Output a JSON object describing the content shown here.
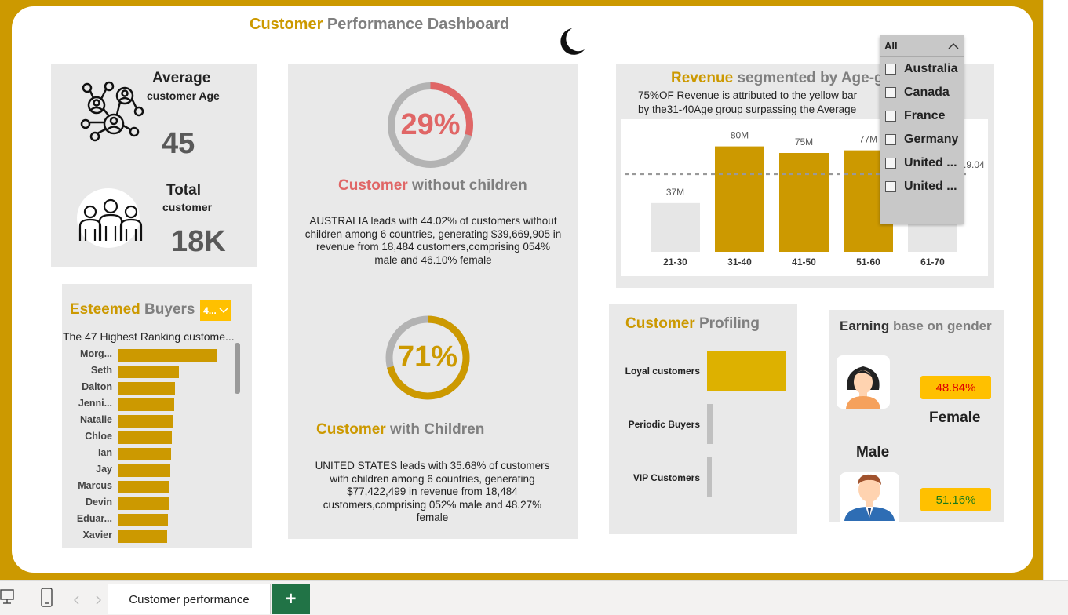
{
  "dashboard": {
    "title_part1": "Customer",
    "title_part2": " Performance Dashboard"
  },
  "age_card": {
    "title": "Average",
    "subtitle": "customer Age",
    "value": "45",
    "total_title": "Total",
    "total_subtitle": "customer",
    "total_value": "18K"
  },
  "donut_without": {
    "percent": "29%",
    "fraction": 0.29,
    "title_part1": "Customer",
    "title_part2": " without children",
    "description": "AUSTRALIA leads with 44.02% of customers without children among 6 countries, generating $39,669,905 in revenue from 18,484 customers,comprising 054% male and  46.10% female",
    "color": "#E06666"
  },
  "donut_with": {
    "percent": "71%",
    "fraction": 0.71,
    "title_part1": "Customer",
    "title_part2": " with Children",
    "description": "UNITED STATES leads with 35.68% of customers with children among 6 countries, generating $77,422,499 in revenue from 18,484 customers,comprising 052% male and  48.27% female",
    "color": "#CC9900"
  },
  "revenue_card": {
    "title_part1": "Revenue",
    "title_part2": " segmented by Age-g",
    "subtitle_line1": "75%OF Revenue is attributed to the yellow bar",
    "subtitle_line2": "by the31-40Age group surpassing the Average",
    "avg_label": ".9.04"
  },
  "chart_data": {
    "type": "bar",
    "categories": [
      "21-30",
      "31-40",
      "41-50",
      "51-60",
      "61-70"
    ],
    "values": [
      37,
      80,
      75,
      77,
      40
    ],
    "data_labels": [
      "37M",
      "80M",
      "75M",
      "77M",
      ""
    ],
    "highlight": [
      false,
      true,
      true,
      true,
      false
    ],
    "average_line": 59.04,
    "ylim": [
      0,
      100
    ],
    "colors": {
      "highlight": "#CC9900",
      "normal": "#e6e6e6",
      "avg_line": "#999999"
    }
  },
  "slicer": {
    "header": "All",
    "items": [
      "Australia",
      "Canada",
      "France",
      "Germany",
      "United ...",
      "United ..."
    ]
  },
  "buyers_card": {
    "title_part1": "Esteemed",
    "title_part2": " Buyers",
    "dropdown_value": "4...",
    "subtitle": "The 47 Highest Ranking custome...",
    "names": [
      "Morg...",
      "Seth",
      "Dalton",
      "Jenni...",
      "Natalie",
      "Chloe",
      "Ian",
      "Jay",
      "Marcus",
      "Devin",
      "Eduar...",
      "Xavier"
    ],
    "values": [
      100,
      62,
      58,
      57,
      56,
      55,
      54,
      53,
      52,
      52,
      51,
      50
    ]
  },
  "profiling_card": {
    "title_part1": "Customer",
    "title_part2": " Profiling",
    "categories": [
      "Loyal customers",
      "Periodic Buyers",
      "VIP Customers"
    ],
    "values": [
      100,
      7,
      6
    ]
  },
  "gender_card": {
    "title_part1": "Earning",
    "title_part2": " base on gender",
    "female_label": "Female",
    "female_pct": "48.84%",
    "male_label": "Male",
    "male_pct": "51.16%"
  },
  "tabs": {
    "active": "Customer performance",
    "add": "+"
  }
}
